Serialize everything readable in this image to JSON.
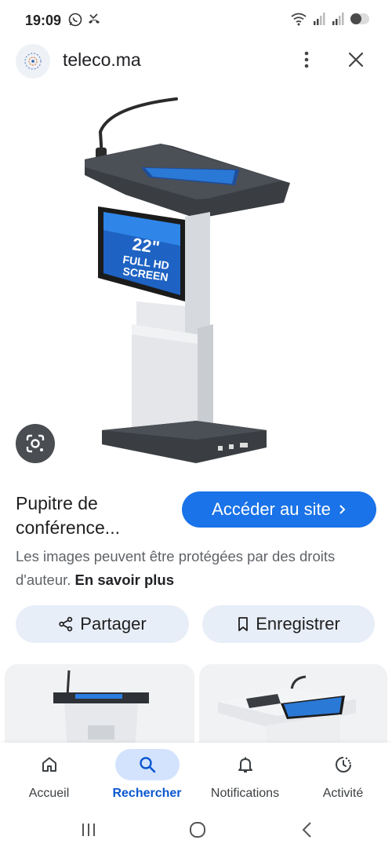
{
  "status_bar": {
    "time": "19:09",
    "left_icons": [
      "whatsapp-icon",
      "missed-call-icon"
    ],
    "right_icons": [
      "wifi-icon",
      "signal-icon",
      "signal-icon",
      "battery-icon"
    ]
  },
  "header": {
    "site_name": "teleco.ma",
    "icons": [
      "site-favicon",
      "more-vert-icon",
      "close-icon"
    ]
  },
  "image": {
    "screen_text_line1": "22\"",
    "screen_text_line2": "FULL HD",
    "screen_text_line3": "SCREEN",
    "lens_icon": "google-lens-icon"
  },
  "result": {
    "title": "Pupitre de conférence...",
    "visit_button": "Accéder au site",
    "visit_icon": "chevron-right-icon",
    "copyright_text": "Les images peuvent être protégées par des droits d'auteur.",
    "learn_more": "En savoir plus"
  },
  "actions": {
    "share_label": "Partager",
    "share_icon": "share-icon",
    "save_label": "Enregistrer",
    "save_icon": "bookmark-icon"
  },
  "bottom_nav": {
    "items": [
      {
        "label": "Accueil",
        "icon": "home-icon",
        "active": false
      },
      {
        "label": "Rechercher",
        "icon": "search-icon",
        "active": true
      },
      {
        "label": "Notifications",
        "icon": "bell-icon",
        "active": false
      },
      {
        "label": "Activité",
        "icon": "activity-icon",
        "active": false
      }
    ]
  },
  "system_nav": {
    "icons": [
      "recent-apps-icon",
      "home-circle-icon",
      "back-icon"
    ]
  },
  "colors": {
    "accent": "#1a73e8",
    "action_button_bg": "#e8eef8",
    "nav_active_bg": "#d3e3fd",
    "nav_active_text": "#0b57d0"
  }
}
